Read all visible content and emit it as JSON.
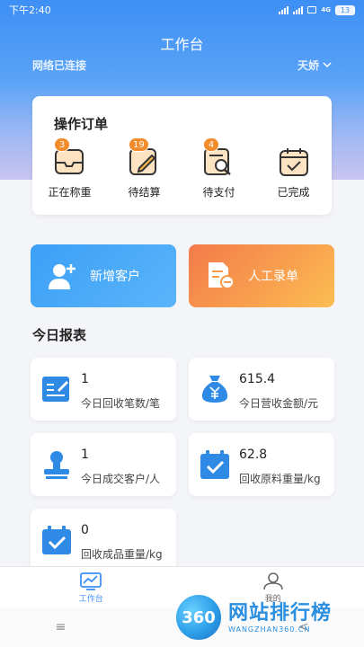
{
  "status_bar": {
    "time": "下午2:40",
    "network_tag": "4G",
    "battery": "13"
  },
  "header": {
    "title": "工作台",
    "connection_status": "网络已连接",
    "date_filter": "天娇"
  },
  "order_card": {
    "title": "操作订单",
    "items": [
      {
        "label": "正在称重",
        "badge": "3",
        "icon": "scale-inbox-icon"
      },
      {
        "label": "待结算",
        "badge": "19",
        "icon": "pen-note-icon"
      },
      {
        "label": "待支付",
        "badge": "4",
        "icon": "search-bill-icon"
      },
      {
        "label": "已完成",
        "badge": "",
        "icon": "calendar-check-icon"
      }
    ]
  },
  "actions": {
    "add_customer": {
      "label": "新增客户",
      "icon": "add-user-icon"
    },
    "manual_entry": {
      "label": "人工录单",
      "icon": "document-edit-icon"
    }
  },
  "report": {
    "title": "今日报表",
    "stats": [
      {
        "value": "1",
        "label": "今日回收笔数/笔",
        "icon": "ledger-pen-icon"
      },
      {
        "value": "615.4",
        "label": "今日营收金额/元",
        "icon": "money-bag-icon"
      },
      {
        "value": "1",
        "label": "今日成交客户/人",
        "icon": "customer-stamp-icon"
      },
      {
        "value": "62.8",
        "label": "回收原料重量/kg",
        "icon": "calendar-check-icon"
      },
      {
        "value": "0",
        "label": "回收成品重量/kg",
        "icon": "calendar-check-icon"
      }
    ]
  },
  "tabbar": {
    "tabs": [
      {
        "label": "工作台",
        "icon": "dashboard-icon",
        "active": true
      },
      {
        "label": "我的",
        "icon": "user-icon",
        "active": false
      }
    ]
  },
  "nav": {
    "menu_glyph": "≡",
    "back_glyph": "<"
  },
  "watermark": {
    "logo": "360",
    "cn": "网站排行榜",
    "en": "WANGZHAN360.CN"
  },
  "colors": {
    "primary": "#3e8ff5",
    "badge": "#f28b2a",
    "orange_gradient": "#f47a4a",
    "blue_gradient": "#3ca0f7"
  }
}
